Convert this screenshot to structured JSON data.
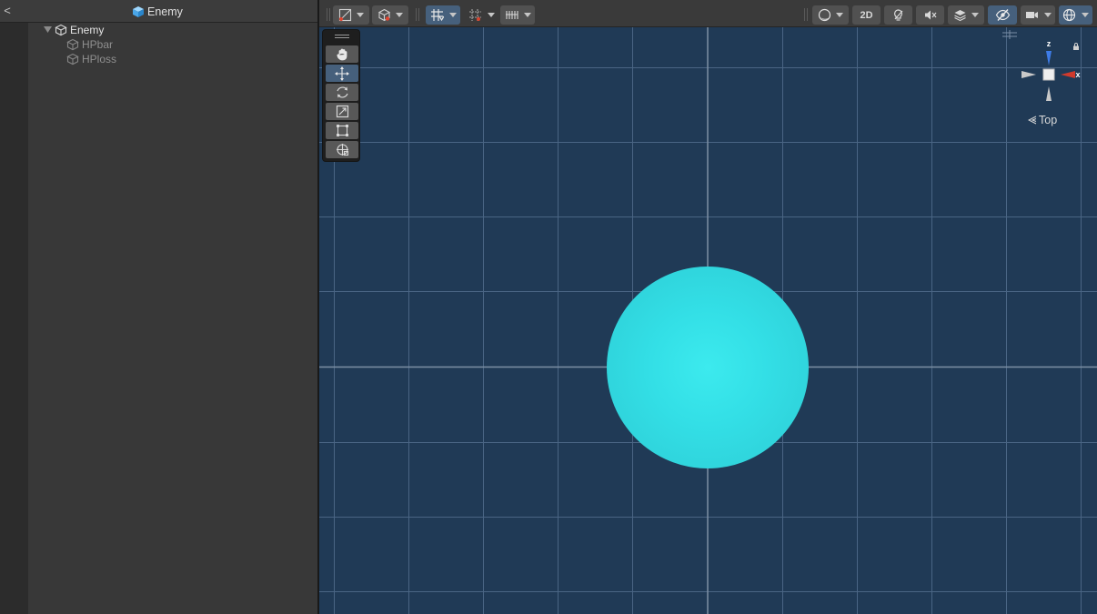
{
  "hierarchy": {
    "back_label": "<",
    "title": "Enemy",
    "title_icon": "prefab-cube-icon",
    "tree": [
      {
        "label": "Enemy",
        "icon": "gameobject-cube-icon",
        "expanded": true
      },
      {
        "label": "HPbar",
        "icon": "gameobject-cube-icon",
        "inactive": true
      },
      {
        "label": "HPloss",
        "icon": "gameobject-cube-icon",
        "inactive": true
      }
    ]
  },
  "scene_toolbar": {
    "buttons": [
      {
        "name": "draw-mode",
        "icon": "shaded-draw-icon",
        "dropdown": true
      },
      {
        "name": "render-mode",
        "icon": "gizmo-cube-icon",
        "dropdown": true
      },
      {
        "name": "grid-snap",
        "icon": "grid-snap-icon",
        "dropdown": true,
        "active": true
      },
      {
        "name": "increment-snap",
        "icon": "increment-snap-icon",
        "dropdown": true
      },
      {
        "name": "ruler",
        "icon": "ruler-icon",
        "dropdown": true
      },
      {
        "name": "shading",
        "icon": "shading-sphere-icon",
        "dropdown": true
      },
      {
        "name": "2d-toggle",
        "label": "2D"
      },
      {
        "name": "lighting",
        "icon": "light-bulb-icon"
      },
      {
        "name": "audio",
        "icon": "audio-mute-icon"
      },
      {
        "name": "effects",
        "icon": "layers-icon",
        "dropdown": true
      },
      {
        "name": "scene-visibility",
        "icon": "hidden-eye-icon",
        "active": true
      },
      {
        "name": "camera",
        "icon": "camera-icon",
        "dropdown": true
      },
      {
        "name": "gizmos",
        "icon": "gizmo-globe-icon",
        "dropdown": true,
        "active": true
      }
    ],
    "label_2d": "2D"
  },
  "tool_palette": {
    "tools": [
      {
        "name": "hand",
        "icon": "hand-icon"
      },
      {
        "name": "move",
        "icon": "move-arrows-icon",
        "active": true
      },
      {
        "name": "rotate",
        "icon": "rotate-icon"
      },
      {
        "name": "scale",
        "icon": "scale-icon"
      },
      {
        "name": "rect",
        "icon": "rect-transform-icon"
      },
      {
        "name": "transform",
        "icon": "transform-icon"
      }
    ]
  },
  "gizmo": {
    "z_label": "z",
    "x_label": "x",
    "view_label": "Top",
    "view_icon": "perspective-chevron-icon",
    "colors": {
      "z": "#3e7ce8",
      "x": "#d03a2c",
      "neutral": "#c9c9c9"
    }
  },
  "scene": {
    "background": "#203a56",
    "sphere_color": "#33dfe6",
    "object_name": "Enemy"
  }
}
